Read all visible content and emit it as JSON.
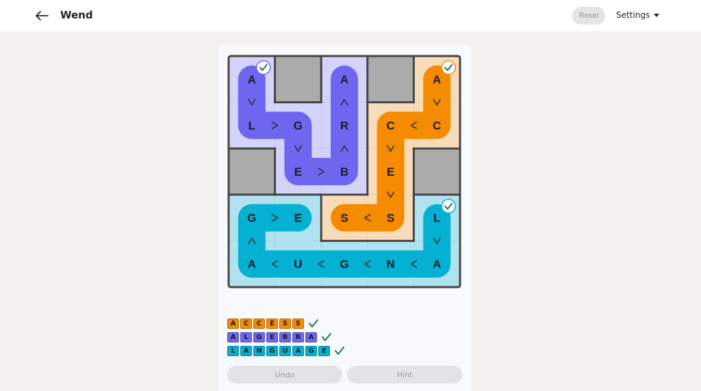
{
  "header": {
    "title": "Wend",
    "reset_label": "Reset",
    "settings_label": "Settings"
  },
  "board": {
    "rows": 5,
    "cols": 5,
    "letters": [
      [
        "A",
        "",
        "A",
        "",
        "A"
      ],
      [
        "L",
        "G",
        "R",
        "C",
        "C"
      ],
      [
        "",
        "E",
        "B",
        "E",
        ""
      ],
      [
        "G",
        "E",
        "S",
        "S",
        "L"
      ],
      [
        "A",
        "U",
        "G",
        "N",
        "A"
      ]
    ],
    "blocked": [
      [
        0,
        1
      ],
      [
        0,
        3
      ],
      [
        2,
        0
      ],
      [
        2,
        4
      ]
    ],
    "regions": [
      {
        "word": "ALGEBRA",
        "color": "#d4d4fb",
        "cells": [
          [
            0,
            0
          ],
          [
            1,
            0
          ],
          [
            1,
            1
          ],
          [
            2,
            1
          ],
          [
            2,
            2
          ],
          [
            1,
            2
          ],
          [
            0,
            2
          ]
        ]
      },
      {
        "word": "ACCESS",
        "color": "#f8dcba",
        "cells": [
          [
            0,
            4
          ],
          [
            1,
            4
          ],
          [
            1,
            3
          ],
          [
            2,
            3
          ],
          [
            3,
            3
          ],
          [
            3,
            2
          ]
        ]
      },
      {
        "word": "LANGUAGE",
        "color": "#b0e3ef",
        "cells": [
          [
            3,
            4
          ],
          [
            4,
            4
          ],
          [
            4,
            3
          ],
          [
            4,
            2
          ],
          [
            4,
            1
          ],
          [
            4,
            0
          ],
          [
            3,
            0
          ],
          [
            3,
            1
          ]
        ]
      }
    ],
    "paths": [
      {
        "word": "ALGEBRA",
        "color": "#6f66f0",
        "cells": [
          [
            0,
            0
          ],
          [
            1,
            0
          ],
          [
            1,
            1
          ],
          [
            2,
            1
          ],
          [
            2,
            2
          ],
          [
            1,
            2
          ],
          [
            0,
            2
          ]
        ],
        "solved": true
      },
      {
        "word": "ACCESS",
        "color": "#f58b00",
        "cells": [
          [
            0,
            4
          ],
          [
            1,
            4
          ],
          [
            1,
            3
          ],
          [
            2,
            3
          ],
          [
            3,
            3
          ],
          [
            3,
            2
          ]
        ],
        "solved": true
      },
      {
        "word": "LANGUAGE",
        "color": "#05b1d2",
        "cells": [
          [
            3,
            4
          ],
          [
            4,
            4
          ],
          [
            4,
            3
          ],
          [
            4,
            2
          ],
          [
            4,
            1
          ],
          [
            4,
            0
          ],
          [
            3,
            0
          ],
          [
            3,
            1
          ]
        ],
        "solved": true
      }
    ]
  },
  "words": [
    {
      "letters": [
        "A",
        "C",
        "C",
        "E",
        "S",
        "S"
      ],
      "color": "#f58b00",
      "solved": true
    },
    {
      "letters": [
        "A",
        "L",
        "G",
        "E",
        "B",
        "R",
        "A"
      ],
      "color": "#6f66f0",
      "solved": true
    },
    {
      "letters": [
        "L",
        "A",
        "N",
        "G",
        "U",
        "A",
        "G",
        "E"
      ],
      "color": "#05b1d2",
      "solved": true
    }
  ],
  "icons": {
    "back": "arrow-left-icon",
    "check": "checkmark-icon",
    "caret": "caret-down-icon"
  },
  "colors": {
    "check_green": "#127a58",
    "blocked_cell": "#ababab",
    "grid_border": "#444444"
  },
  "buttons": {
    "undo_label": "Undo",
    "hint_label": "Hint"
  }
}
